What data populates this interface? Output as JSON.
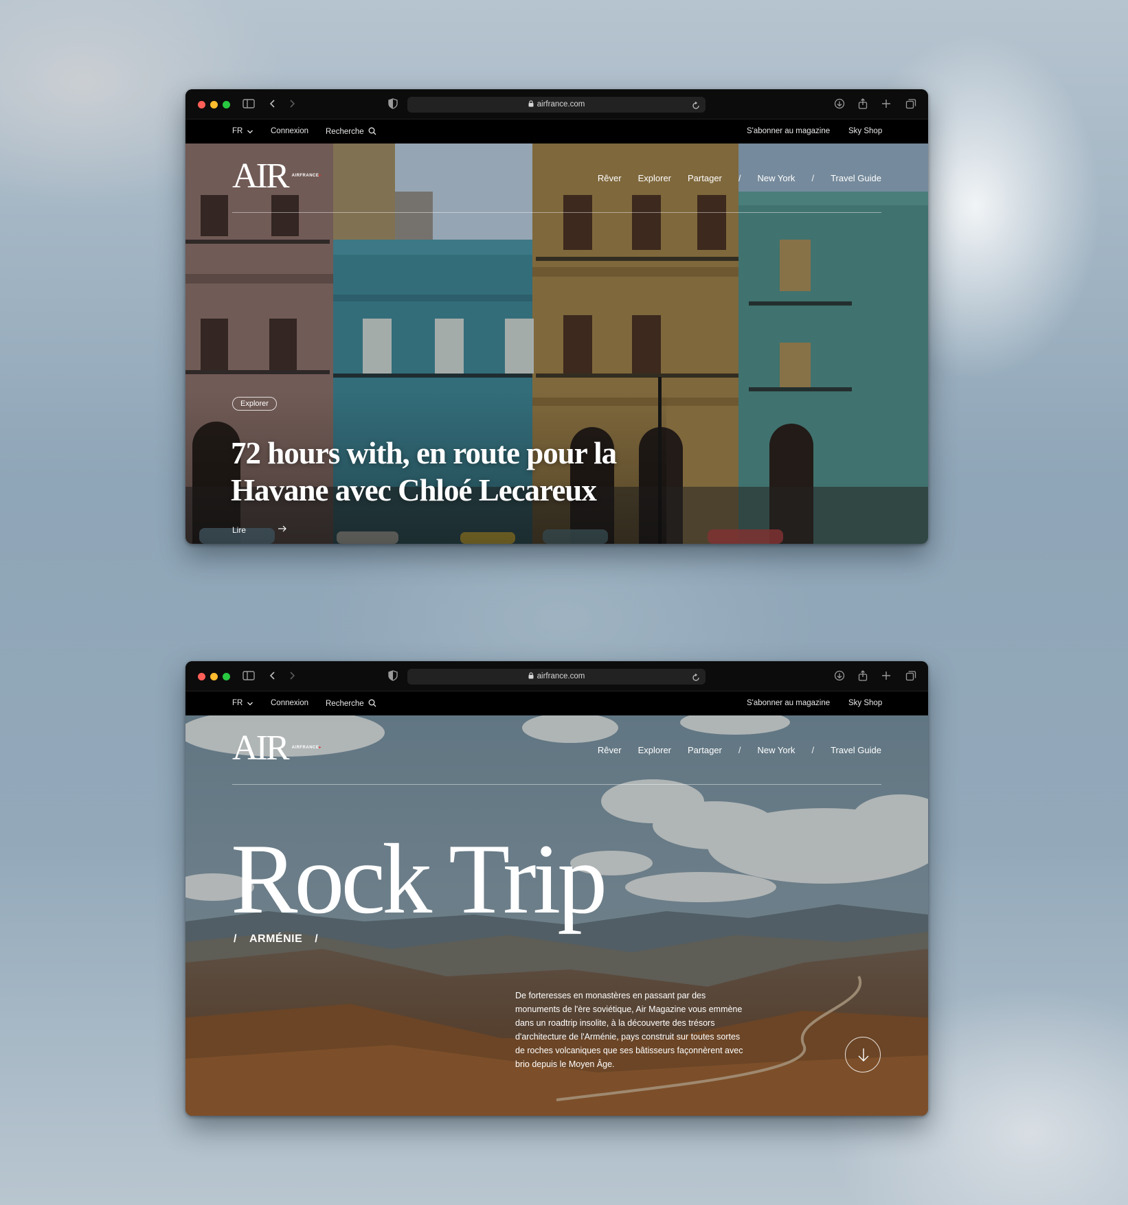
{
  "browser": {
    "url": "airfrance.com"
  },
  "site_bar": {
    "lang": "FR",
    "connexion": "Connexion",
    "recherche": "Recherche",
    "subscribe": "S'abonner au magazine",
    "shop": "Sky Shop"
  },
  "brand": {
    "logo_text": "AIR",
    "logo_sub": "AIRFRANCE"
  },
  "nav": {
    "items": [
      "Rêver",
      "Explorer",
      "Partager"
    ],
    "separator": "/",
    "city": "New York",
    "guide": "Travel Guide"
  },
  "page1": {
    "tag": "Explorer",
    "headline": "72 hours with, en route pour la Havane avec Chloé Lecareux",
    "read_label": "Lire"
  },
  "page2": {
    "title": "Rock Trip",
    "subtitle": "ARMÉNIE",
    "slash": "/",
    "description": "De forteresses en monastères en passant par des monuments de l'ère soviétique, Air Magazine vous emmène dans un roadtrip insolite, à la découverte des trésors d'architecture de l'Arménie, pays construit sur toutes sortes de roches volcaniques que ses bâtisseurs façonnèrent avec brio depuis le Moyen Âge."
  },
  "icons": {
    "sidebar": "sidebar-icon",
    "back": "chevron-left-icon",
    "forward": "chevron-right-icon",
    "shield": "shield-icon",
    "lock": "lock-icon",
    "reload": "reload-icon",
    "download": "download-icon",
    "share": "share-icon",
    "new_tab": "plus-icon",
    "tabs": "tabs-icon",
    "search": "search-icon",
    "lang_dropdown": "chevron-down-icon",
    "arrow_right": "arrow-right-icon",
    "scroll_down": "arrow-down-icon"
  },
  "colors": {
    "background": "#9fb3c3",
    "chrome": "#0c0c0c",
    "traffic_red": "#fe5f57",
    "traffic_yellow": "#febc2e",
    "traffic_green": "#28c840",
    "brand_red": "#e03030"
  }
}
